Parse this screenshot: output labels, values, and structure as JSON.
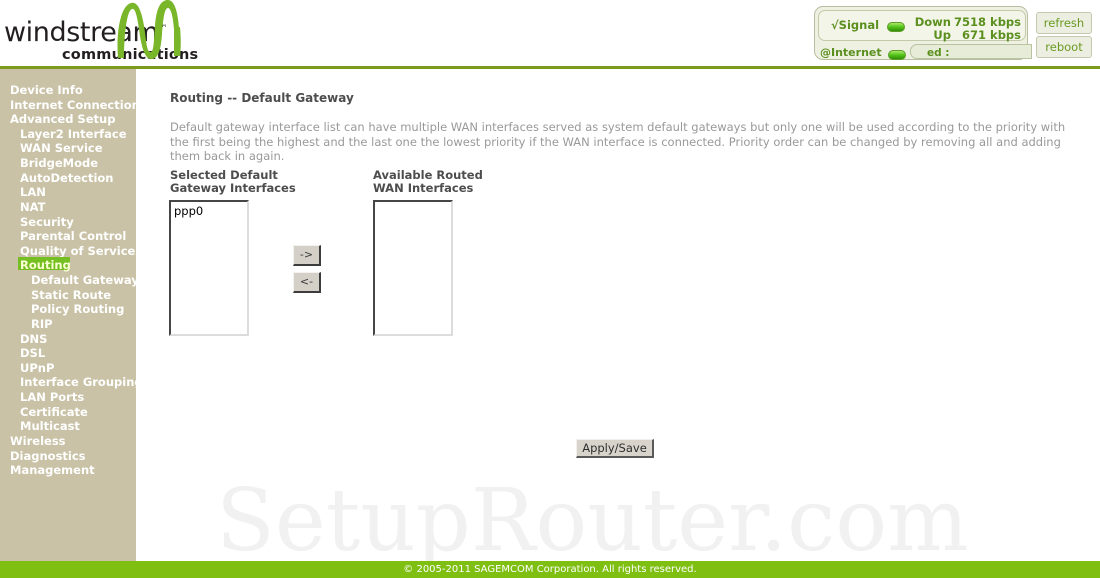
{
  "header": {
    "logo": {
      "wordmark": "windstream",
      "trademark": "™",
      "subtitle": "communications",
      "mark_name": "windstream-w-logo",
      "mark_color": "#7ab629"
    },
    "status": {
      "signal_label": "√Signal",
      "signal_led": "on",
      "internet_label": "@Internet",
      "internet_led": "on",
      "internet_field_value": "ed :",
      "down_label": "Down",
      "down_value": "7518 kbps",
      "up_label": "Up",
      "up_value": "671 kbps",
      "refresh_label": "refresh",
      "reboot_label": "reboot"
    }
  },
  "sidebar": {
    "active_item": "Routing",
    "items": [
      {
        "label": "Device Info",
        "level": 0,
        "active": false
      },
      {
        "label": "Internet Connection",
        "level": 0,
        "active": false
      },
      {
        "label": "Advanced Setup",
        "level": 0,
        "active": false
      },
      {
        "label": "Layer2 Interface",
        "level": 1,
        "active": false
      },
      {
        "label": "WAN Service",
        "level": 1,
        "active": false
      },
      {
        "label": "BridgeMode",
        "level": 1,
        "active": false
      },
      {
        "label": "AutoDetection",
        "level": 1,
        "active": false
      },
      {
        "label": "LAN",
        "level": 1,
        "active": false
      },
      {
        "label": "NAT",
        "level": 1,
        "active": false
      },
      {
        "label": "Security",
        "level": 1,
        "active": false
      },
      {
        "label": "Parental Control",
        "level": 1,
        "active": false
      },
      {
        "label": "Quality of Service",
        "level": 1,
        "active": false
      },
      {
        "label": "Routing",
        "level": 1,
        "active": true
      },
      {
        "label": "Default Gateway",
        "level": 2,
        "active": false
      },
      {
        "label": "Static Route",
        "level": 2,
        "active": false
      },
      {
        "label": "Policy Routing",
        "level": 2,
        "active": false
      },
      {
        "label": "RIP",
        "level": 2,
        "active": false
      },
      {
        "label": "DNS",
        "level": 1,
        "active": false
      },
      {
        "label": "DSL",
        "level": 1,
        "active": false
      },
      {
        "label": "UPnP",
        "level": 1,
        "active": false
      },
      {
        "label": "Interface Grouping",
        "level": 1,
        "active": false
      },
      {
        "label": "LAN Ports",
        "level": 1,
        "active": false
      },
      {
        "label": "Certificate",
        "level": 1,
        "active": false
      },
      {
        "label": "Multicast",
        "level": 1,
        "active": false
      },
      {
        "label": "Wireless",
        "level": 0,
        "active": false
      },
      {
        "label": "Diagnostics",
        "level": 0,
        "active": false
      },
      {
        "label": "Management",
        "level": 0,
        "active": false
      }
    ]
  },
  "main": {
    "title": "Routing -- Default Gateway",
    "description": "Default gateway interface list can have multiple WAN interfaces served as system default gateways but only one will be used according to the priority with the first being the highest and the last one the lowest priority if the WAN interface is connected. Priority order can be changed by removing all and adding them back in again.",
    "selected_label": "Selected Default Gateway Interfaces",
    "available_label": "Available Routed WAN Interfaces",
    "selected_items": [
      "ppp0"
    ],
    "available_items": [],
    "add_button_label": "->",
    "remove_button_label": "<-",
    "apply_button_label": "Apply/Save",
    "watermark": "SetupRouter.com"
  },
  "footer": {
    "copyright": "© 2005-2011 SAGEMCOM Corporation. All rights reserved."
  },
  "colors": {
    "brand_green": "#7ab629",
    "rule_green": "#7b9a1e",
    "footer_green": "#7fbf12",
    "sidebar_tan": "#c9c2a6",
    "active_green": "#76bf22",
    "status_text_green": "#5b8f1e"
  }
}
